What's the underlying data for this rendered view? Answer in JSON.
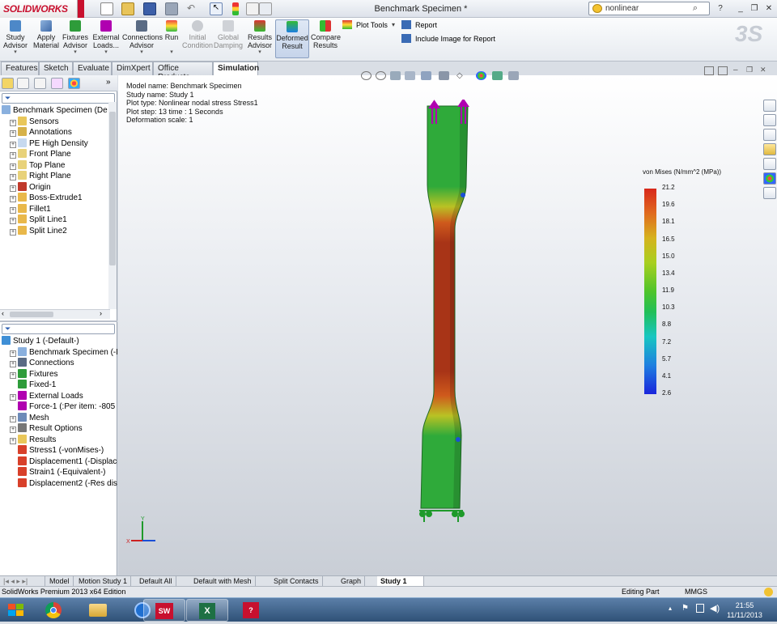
{
  "app": {
    "brand": "SOLIDWORKS",
    "document_title": "Benchmark Specimen *"
  },
  "search": {
    "value": "nonlinear"
  },
  "command_manager": {
    "buttons": [
      {
        "label": "Study Advisor",
        "line1": "Study",
        "line2": "Advisor",
        "enabled": true
      },
      {
        "label": "Apply Material",
        "line1": "Apply",
        "line2": "Material",
        "enabled": true
      },
      {
        "label": "Fixtures Advisor",
        "line1": "Fixtures",
        "line2": "Advisor",
        "enabled": true
      },
      {
        "label": "External Loads...",
        "line1": "External",
        "line2": "Loads...",
        "enabled": true
      },
      {
        "label": "Connections Advisor",
        "line1": "Connections",
        "line2": "Advisor",
        "enabled": true
      },
      {
        "label": "Run",
        "line1": "Run",
        "line2": "",
        "enabled": true
      },
      {
        "label": "Initial Condition",
        "line1": "Initial",
        "line2": "Condition",
        "enabled": false
      },
      {
        "label": "Global Damping",
        "line1": "Global",
        "line2": "Damping",
        "enabled": false
      },
      {
        "label": "Results Advisor",
        "line1": "Results",
        "line2": "Advisor",
        "enabled": true
      },
      {
        "label": "Deformed Result",
        "line1": "Deformed",
        "line2": "Result",
        "enabled": true,
        "selected": true
      },
      {
        "label": "Compare Results",
        "line1": "Compare",
        "line2": "Results",
        "enabled": true
      }
    ],
    "plot_tools": "Plot Tools",
    "report": "Report",
    "include_image": "Include Image for Report"
  },
  "tabs": [
    "Features",
    "Sketch",
    "Evaluate",
    "DimXpert",
    "Office Products",
    "Simulation"
  ],
  "active_tab": "Simulation",
  "feature_tree": [
    {
      "label": "Benchmark Specimen  (De",
      "indent": 0
    },
    {
      "label": "Sensors",
      "indent": 1
    },
    {
      "label": "Annotations",
      "indent": 1
    },
    {
      "label": "PE High Density",
      "indent": 1
    },
    {
      "label": "Front Plane",
      "indent": 1
    },
    {
      "label": "Top Plane",
      "indent": 1
    },
    {
      "label": "Right Plane",
      "indent": 1
    },
    {
      "label": "Origin",
      "indent": 1
    },
    {
      "label": "Boss-Extrude1",
      "indent": 1
    },
    {
      "label": "Fillet1",
      "indent": 1
    },
    {
      "label": "Split Line1",
      "indent": 1
    },
    {
      "label": "Split Line2",
      "indent": 1
    }
  ],
  "study_tree": [
    {
      "label": "Study 1 (-Default-)",
      "indent": 0
    },
    {
      "label": "Benchmark Specimen (-PE H",
      "indent": 1
    },
    {
      "label": "Connections",
      "indent": 1
    },
    {
      "label": "Fixtures",
      "indent": 1
    },
    {
      "label": "Fixed-1",
      "indent": 2
    },
    {
      "label": "External Loads",
      "indent": 1
    },
    {
      "label": "Force-1 (:Per item: -805 N",
      "indent": 2
    },
    {
      "label": "Mesh",
      "indent": 1
    },
    {
      "label": "Result Options",
      "indent": 1
    },
    {
      "label": "Results",
      "indent": 1
    },
    {
      "label": "Stress1 (-vonMises-)",
      "indent": 2
    },
    {
      "label": "Displacement1 (-Displace",
      "indent": 2
    },
    {
      "label": "Strain1 (-Equivalent-)",
      "indent": 2
    },
    {
      "label": "Displacement2 (-Res disp",
      "indent": 2
    }
  ],
  "model_info": [
    "Model name: Benchmark Specimen",
    "Study name: Study 1",
    "Plot type: Nonlinear nodal stress Stress1",
    "Plot step: 13   time : 1 Seconds",
    "Deformation scale: 1"
  ],
  "legend": {
    "title": "von Mises (N/mm^2 (MPa))",
    "ticks": [
      "21.2",
      "19.6",
      "18.1",
      "16.5",
      "15.0",
      "13.4",
      "11.9",
      "10.3",
      "8.8",
      "7.2",
      "5.7",
      "4.1",
      "2.6"
    ]
  },
  "bottom_tabs": [
    "Model",
    "Motion Study 1",
    "Default All",
    "Default with Mesh",
    "Split Contacts",
    "Graph",
    "Study 1"
  ],
  "active_bottom_tab": "Study 1",
  "status": {
    "left": "SolidWorks Premium 2013 x64 Edition",
    "mode": "Editing Part",
    "units": "MMGS"
  },
  "clock": {
    "time": "21:55",
    "date": "11/11/2013"
  },
  "colors": {
    "stress_high": "#b33a1a",
    "stress_mid": "#2fae3c",
    "stress_low": "#1a25dc",
    "load_arrow": "#b000b0",
    "fixture": "#1e9a2a"
  }
}
